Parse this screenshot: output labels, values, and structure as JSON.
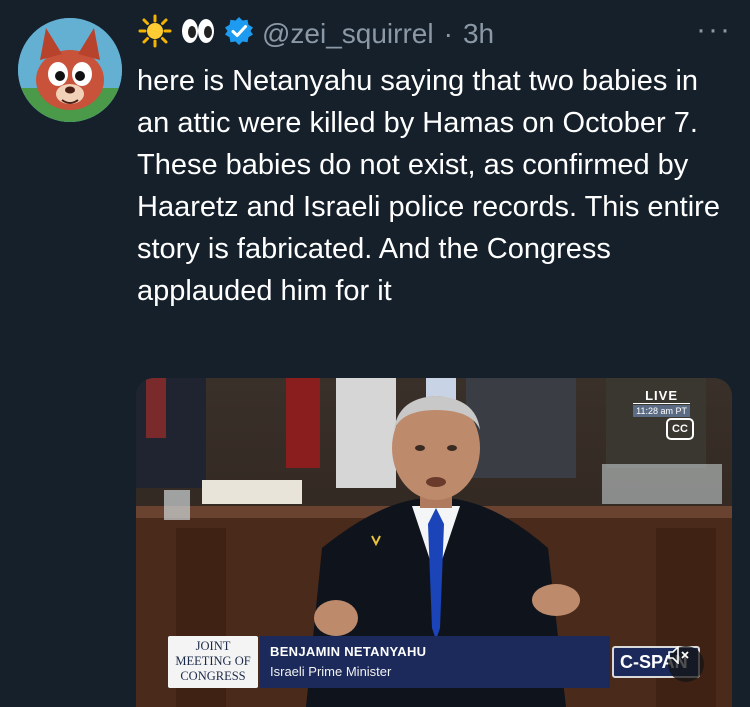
{
  "tweet": {
    "author_emojis": [
      "☀",
      "👀",
      "✔"
    ],
    "handle": "@zei_squirrel",
    "separator": "·",
    "time": "3h",
    "more": "···",
    "text": "here is Netanyahu saying that two babies in an attic were killed by Hamas on October 7. These babies do not exist, as confirmed by Haaretz and Israeli police records. This entire story is fabricated. And the Congress applauded him for it"
  },
  "media": {
    "live_label": "LIVE",
    "live_time": "11:28 am PT",
    "cc_label": "CC",
    "chyron_joint": [
      "JOINT",
      "MEETING OF",
      "CONGRESS"
    ],
    "chyron_name": "BENJAMIN NETANYAHU",
    "chyron_title": "Israeli Prime Minister",
    "network": "C-SPAN",
    "mute_icon": "speaker-muted-icon"
  },
  "colors": {
    "background": "#15202b",
    "secondary_text": "#8b98a5",
    "verified": "#1d9bf0",
    "chyron": "#1b2a5a"
  }
}
